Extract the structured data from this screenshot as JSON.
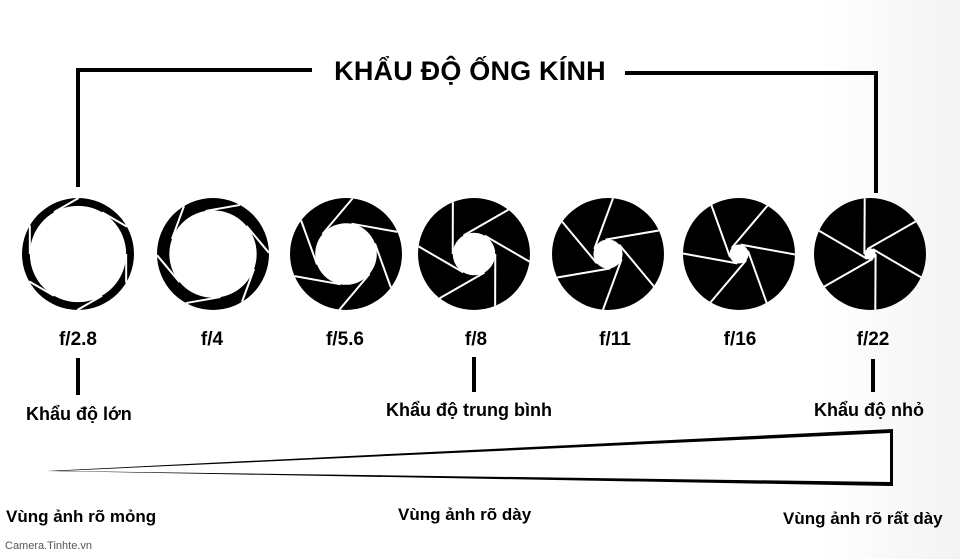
{
  "title": "KHẨU ĐỘ ỐNG KÍNH",
  "apertures": [
    {
      "label": "f/2.8",
      "opening": 0.86
    },
    {
      "label": "f/4",
      "opening": 0.78
    },
    {
      "label": "f/5.6",
      "opening": 0.55
    },
    {
      "label": "f/8",
      "opening": 0.38
    },
    {
      "label": "f/11",
      "opening": 0.26
    },
    {
      "label": "f/16",
      "opening": 0.17
    },
    {
      "label": "f/22",
      "opening": 0.1
    }
  ],
  "categories": {
    "large": "Khẩu độ lớn",
    "medium": "Khẩu độ trung bình",
    "small": "Khẩu độ nhỏ"
  },
  "depth_of_field": {
    "shallow": "Vùng ảnh rõ mỏng",
    "medium": "Vùng ảnh rõ dày",
    "deep": "Vùng ảnh rõ rất dày"
  },
  "watermark": "Camera.Tinhte.vn",
  "colors": {
    "ink": "#000000",
    "paper": "#ffffff",
    "watermark": "#555555"
  }
}
